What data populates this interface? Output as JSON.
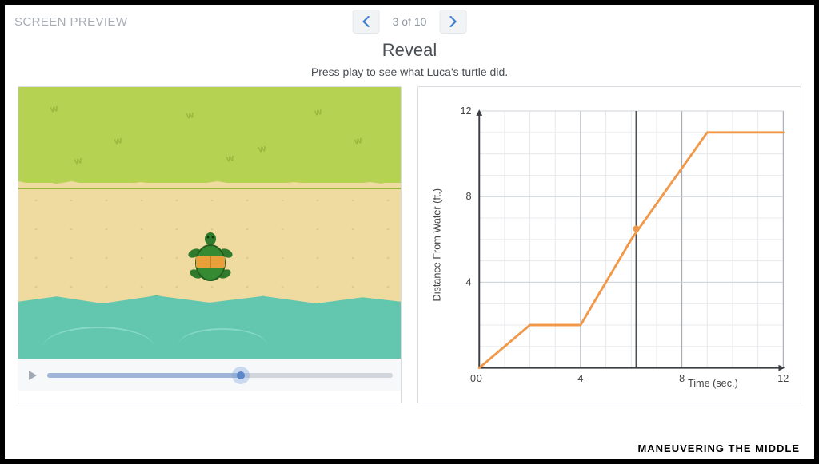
{
  "header": {
    "screen_preview": "SCREEN PREVIEW",
    "page_label": "3 of 10"
  },
  "title": "Reveal",
  "subtitle": "Press play to see what Luca's turtle did.",
  "animation": {
    "scene_name": "turtle-beach-scene"
  },
  "chart_data": {
    "type": "line",
    "xlabel": "Time (sec.)",
    "ylabel": "Distance From Water (ft.)",
    "xlim": [
      0,
      12
    ],
    "ylim": [
      0,
      12
    ],
    "x_ticks": [
      0,
      4,
      8,
      12
    ],
    "y_ticks": [
      4,
      8,
      12
    ],
    "grid_step": 1,
    "highlight_vertical_x": 6.2,
    "series": [
      {
        "name": "turtle-path",
        "color": "#f1994b",
        "points": [
          {
            "x": 0,
            "y": 0
          },
          {
            "x": 2,
            "y": 2
          },
          {
            "x": 4,
            "y": 2
          },
          {
            "x": 6,
            "y": 6
          },
          {
            "x": 9,
            "y": 11
          },
          {
            "x": 12,
            "y": 11
          }
        ],
        "marker_point": {
          "x": 6.2,
          "y": 6.5
        }
      }
    ]
  },
  "footer": "MANEUVERING THE MIDDLE"
}
